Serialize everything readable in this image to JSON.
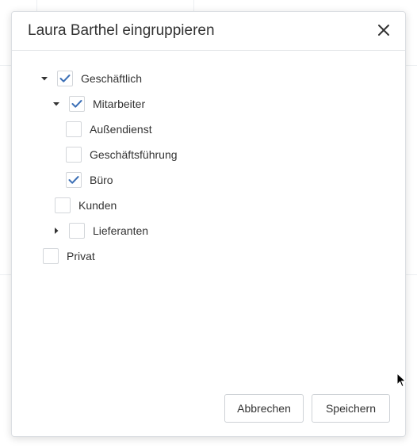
{
  "dialog": {
    "title": "Laura Barthel eingruppieren",
    "close_icon": "close-icon"
  },
  "tree": [
    {
      "label": "Geschäftlich",
      "checked": true,
      "expanded": true,
      "has_children": true,
      "level": 0
    },
    {
      "label": "Mitarbeiter",
      "checked": true,
      "expanded": true,
      "has_children": true,
      "level": 1
    },
    {
      "label": "Außendienst",
      "checked": false,
      "has_children": false,
      "level": 2
    },
    {
      "label": "Geschäftsführung",
      "checked": false,
      "has_children": false,
      "level": 2
    },
    {
      "label": "Büro",
      "checked": true,
      "has_children": false,
      "level": 2
    },
    {
      "label": "Kunden",
      "checked": false,
      "has_children": false,
      "level": 1
    },
    {
      "label": "Lieferanten",
      "checked": false,
      "expanded": false,
      "has_children": true,
      "level": 1
    },
    {
      "label": "Privat",
      "checked": false,
      "has_children": false,
      "level": 0
    }
  ],
  "footer": {
    "cancel_label": "Abbrechen",
    "save_label": "Speichern"
  },
  "colors": {
    "check": "#3b6fb6",
    "text": "#333333",
    "border": "#d3d6da"
  }
}
